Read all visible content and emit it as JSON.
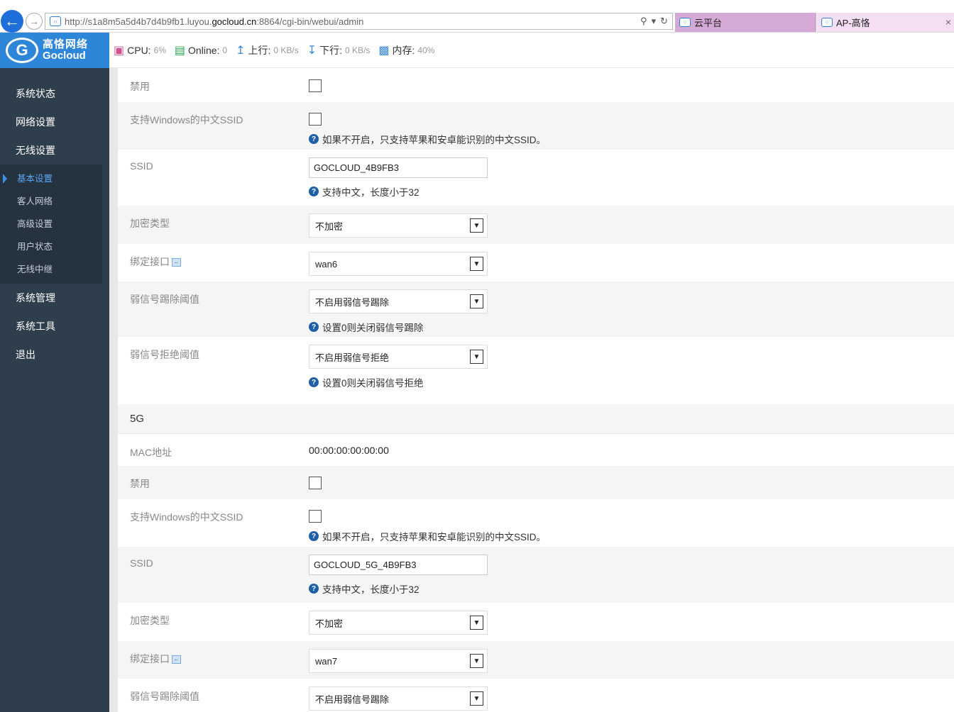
{
  "browser": {
    "url_prefix": "http://s1a8m5a5d4b7d4b9fb1.luyou.",
    "url_domain": "gocloud.cn",
    "url_suffix": ":8864/cgi-bin/webui/admin",
    "tab1": "云平台",
    "tab2": "AP-高恪"
  },
  "logo": {
    "cn": "高恪网络",
    "en": "Gocloud"
  },
  "status": {
    "cpu_label": "CPU:",
    "cpu_value": "6%",
    "online_label": "Online:",
    "online_value": "0",
    "up_label": "上行:",
    "up_value": "0 KB/s",
    "down_label": "下行:",
    "down_value": "0 KB/s",
    "mem_label": "内存:",
    "mem_value": "40%"
  },
  "sidebar": {
    "items": [
      "系统状态",
      "网络设置",
      "无线设置"
    ],
    "sub_items": [
      "基本设置",
      "客人网络",
      "高级设置",
      "用户状态",
      "无线中继"
    ],
    "items_after": [
      "系统管理",
      "系统工具",
      "退出"
    ]
  },
  "band24": {
    "disable_label": "禁用",
    "cn_ssid_label": "支持Windows的中文SSID",
    "cn_ssid_hint": "如果不开启，只支持苹果和安卓能识别的中文SSID。",
    "ssid_label": "SSID",
    "ssid_value": "GOCLOUD_4B9FB3",
    "ssid_hint": "支持中文，长度小于32",
    "enc_label": "加密类型",
    "enc_value": "不加密",
    "bind_label": "绑定接口",
    "bind_value": "wan6",
    "weak_kick_label": "弱信号踢除阈值",
    "weak_kick_value": "不启用弱信号踢除",
    "weak_kick_hint": "设置0则关闭弱信号踢除",
    "weak_reject_label": "弱信号拒绝阈值",
    "weak_reject_value": "不启用弱信号拒绝",
    "weak_reject_hint": "设置0则关闭弱信号拒绝"
  },
  "band5": {
    "title": "5G",
    "mac_label": "MAC地址",
    "mac_value": "00:00:00:00:00:00",
    "disable_label": "禁用",
    "cn_ssid_label": "支持Windows的中文SSID",
    "cn_ssid_hint": "如果不开启，只支持苹果和安卓能识别的中文SSID。",
    "ssid_label": "SSID",
    "ssid_value": "GOCLOUD_5G_4B9FB3",
    "ssid_hint": "支持中文，长度小于32",
    "enc_label": "加密类型",
    "enc_value": "不加密",
    "bind_label": "绑定接口",
    "bind_value": "wan7",
    "weak_kick_label": "弱信号踢除阈值",
    "weak_kick_value": "不启用弱信号踢除"
  }
}
